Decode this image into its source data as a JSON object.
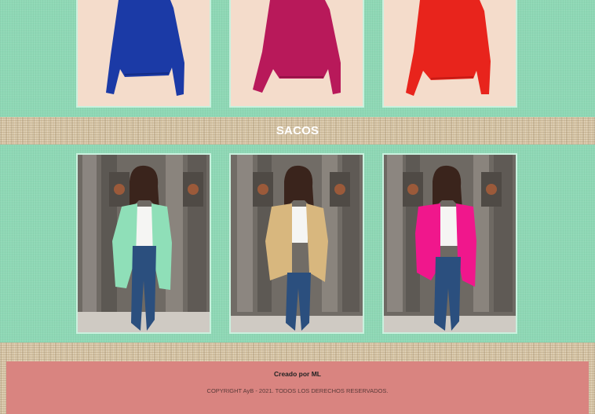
{
  "section": {
    "title": "SACOS"
  },
  "products_top": [
    {
      "color_name": "blue",
      "color": "#1b3aa6"
    },
    {
      "color_name": "magenta",
      "color": "#b8195a"
    },
    {
      "color_name": "red",
      "color": "#e8241c"
    }
  ],
  "products_bottom": [
    {
      "cardigan": "mint",
      "color": "#8fdfb8"
    },
    {
      "cardigan": "beige",
      "color": "#d8b77e"
    },
    {
      "cardigan": "pink",
      "color": "#f0178c"
    }
  ],
  "footer": {
    "credit": "Creado por ML",
    "copyright": "COPYRIGHT AyB - 2021. TODOS LOS DERECHOS RESERVADOS."
  },
  "colors": {
    "background_green": "#8ed8b5",
    "footer_bg": "#d98480",
    "frame_border": "#c9f1de"
  }
}
